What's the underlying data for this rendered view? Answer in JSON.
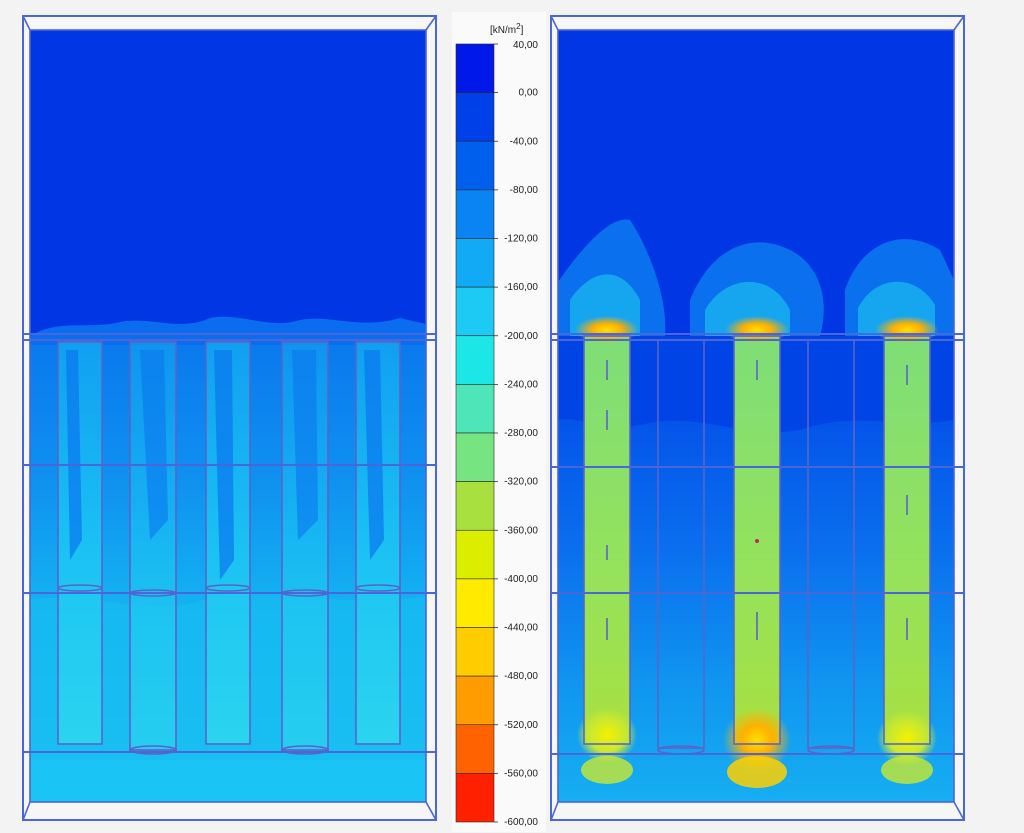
{
  "legend": {
    "unit_base": "[kN/m",
    "unit_sup": "2",
    "unit_close": "]",
    "ticks": [
      "40,00",
      "0,00",
      "-40,00",
      "-80,00",
      "-120,00",
      "-160,00",
      "-200,00",
      "-240,00",
      "-280,00",
      "-320,00",
      "-360,00",
      "-400,00",
      "-440,00",
      "-480,00",
      "-520,00",
      "-560,00",
      "-600,00"
    ],
    "colors": [
      "#0018e8",
      "#0040e8",
      "#0060ee",
      "#0a84f2",
      "#12aaf4",
      "#1ccaf4",
      "#1de6e6",
      "#4ee6b8",
      "#76e480",
      "#a8e040",
      "#dcee00",
      "#ffea00",
      "#ffcc00",
      "#ff9c00",
      "#ff6200",
      "#ff2000"
    ]
  },
  "palette": {
    "deep": "#0036e4",
    "mid": "#0a70ee",
    "light": "#1aa6f0",
    "cyan": "#1ccaf4",
    "green": "#8ee06a",
    "yellow": "#eef000",
    "orange": "#ffb000",
    "frame": "#4a66d8"
  }
}
